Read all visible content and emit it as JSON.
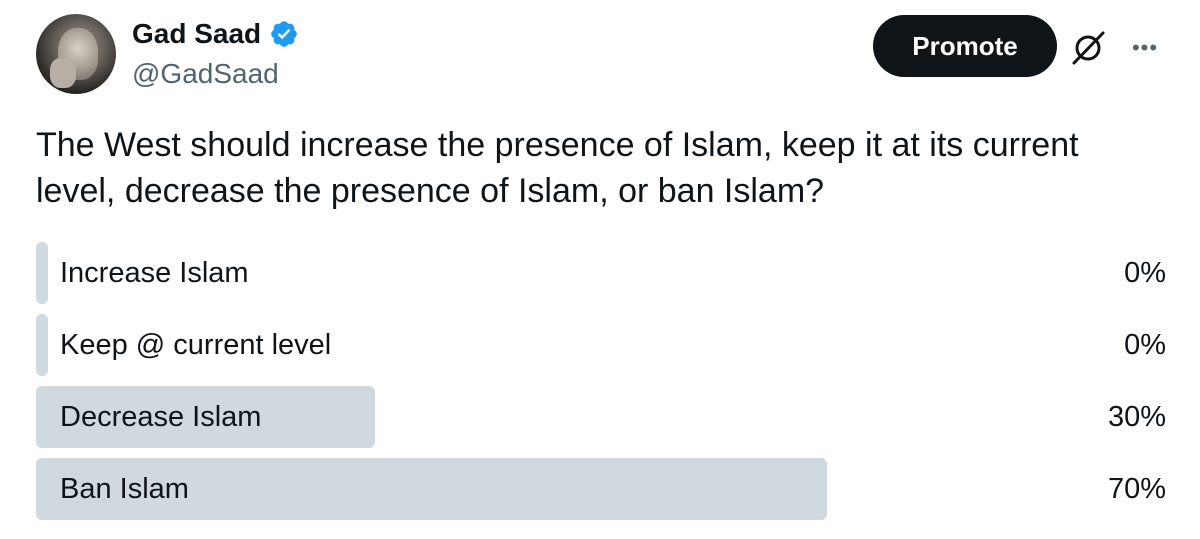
{
  "author": {
    "name": "Gad Saad",
    "handle": "@GadSaad"
  },
  "header": {
    "promote_label": "Promote"
  },
  "icons": {
    "verified": "verified-badge-icon",
    "grok": "grok-icon",
    "more": "more-icon"
  },
  "colors": {
    "verified_blue": "#1d9bf0",
    "promote_bg": "#0f1419",
    "poll_bar": "#cfd9de",
    "secondary_text": "#536471"
  },
  "post": {
    "text": "The West should increase the presence of Islam, keep it at its current level, decrease the presence of Islam, or ban Islam?"
  },
  "poll": {
    "options": [
      {
        "label": "Increase Islam",
        "percent": "0%",
        "share": 0
      },
      {
        "label": "Keep @ current level",
        "percent": "0%",
        "share": 0
      },
      {
        "label": "Decrease Islam",
        "percent": "30%",
        "share": 30
      },
      {
        "label": "Ban Islam",
        "percent": "70%",
        "share": 70
      }
    ]
  }
}
